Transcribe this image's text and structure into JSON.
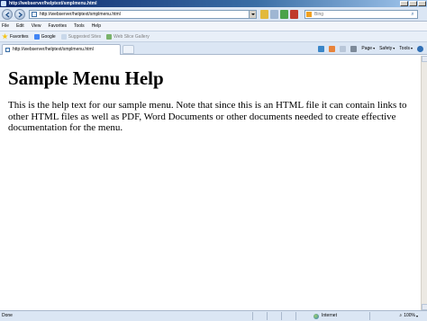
{
  "window": {
    "title": "http://webserver/helptext/smplmenu.html"
  },
  "address": {
    "url": "http://webserver/helptext/smplmenu.html"
  },
  "search": {
    "placeholder": "Bing"
  },
  "menu": {
    "items": [
      "File",
      "Edit",
      "View",
      "Favorites",
      "Tools",
      "Help"
    ]
  },
  "favorites_bar": {
    "favorites_label": "Favorites",
    "items": [
      "Google",
      "Suggested Sites",
      "Web Slice Gallery"
    ]
  },
  "tab": {
    "label": "http://webserver/helptext/smplmenu.html"
  },
  "command_bar": {
    "page_label": "Page",
    "safety_label": "Safety",
    "tools_label": "Tools"
  },
  "page": {
    "heading": "Sample Menu Help",
    "body": "This is the help text for our sample menu. Note that since this is an HTML file it can contain links to other HTML files as well as PDF, Word Documents or other documents needed to create effective documentation for the menu."
  },
  "status": {
    "text": "Done",
    "zone": "Internet",
    "zoom": "100%"
  },
  "colors": {
    "title_bar": "#0a246a",
    "chrome": "#dbe6f4"
  }
}
